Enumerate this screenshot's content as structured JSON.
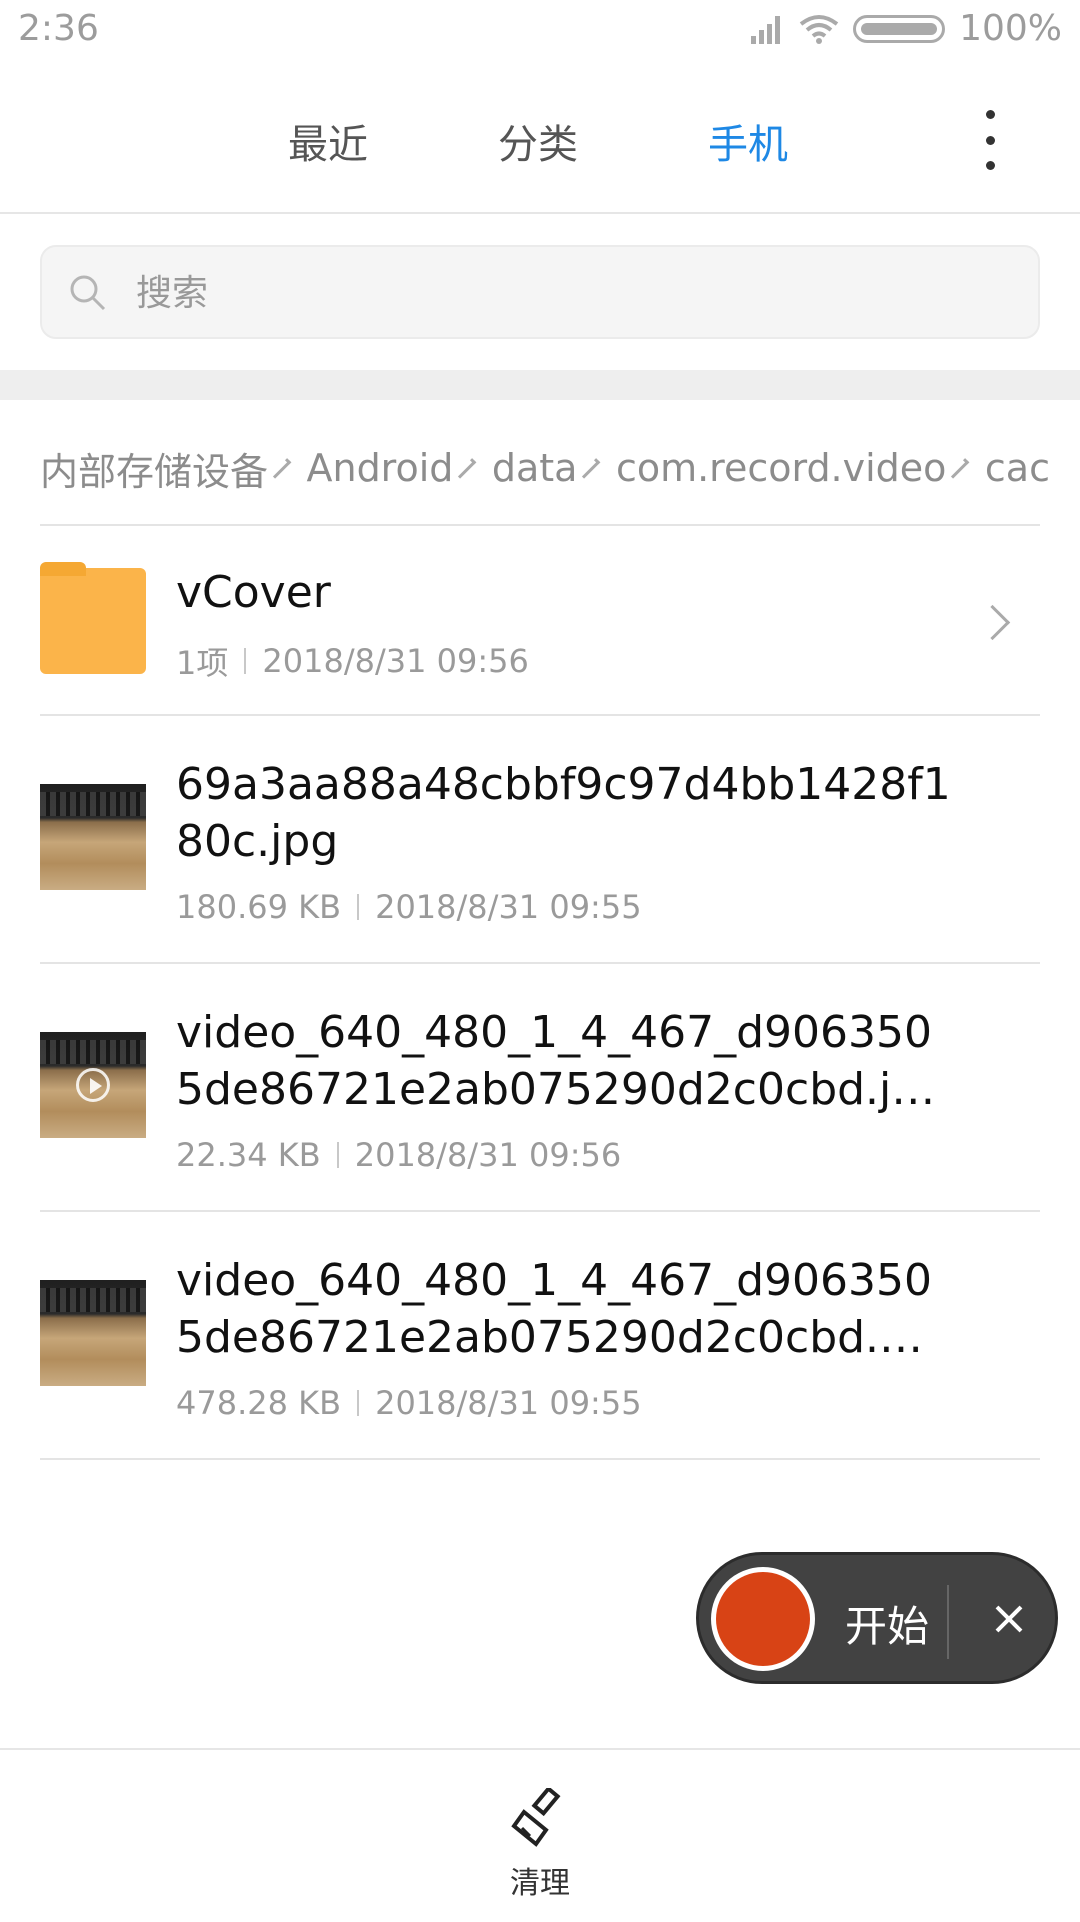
{
  "status_bar": {
    "time": "2:36",
    "battery": "100%"
  },
  "tabs": [
    {
      "label": "最近",
      "active": false
    },
    {
      "label": "分类",
      "active": false
    },
    {
      "label": "手机",
      "active": true
    }
  ],
  "accent_color": "#1e88e5",
  "search": {
    "placeholder": "搜索"
  },
  "breadcrumb": [
    "内部存储设备",
    "Android",
    "data",
    "com.record.video",
    "cac"
  ],
  "files": [
    {
      "type": "folder",
      "name": "vCover",
      "size": "1项",
      "date": "2018/8/31 09:56"
    },
    {
      "type": "image",
      "name": "69a3aa88a48cbbf9c97d4bb1428f180c.jpg",
      "size": "180.69 KB",
      "date": "2018/8/31 09:55"
    },
    {
      "type": "video",
      "name": "video_640_480_1_4_467_d9063505de86721e2ab075290d2c0cbd.j…",
      "size": "22.34 KB",
      "date": "2018/8/31 09:56"
    },
    {
      "type": "image",
      "name": "video_640_480_1_4_467_d9063505de86721e2ab075290d2c0cbd.…",
      "size": "478.28 KB",
      "date": "2018/8/31 09:55"
    }
  ],
  "recorder": {
    "start_label": "开始",
    "record_color": "#d84315"
  },
  "bottom_bar": {
    "clean_label": "清理"
  }
}
